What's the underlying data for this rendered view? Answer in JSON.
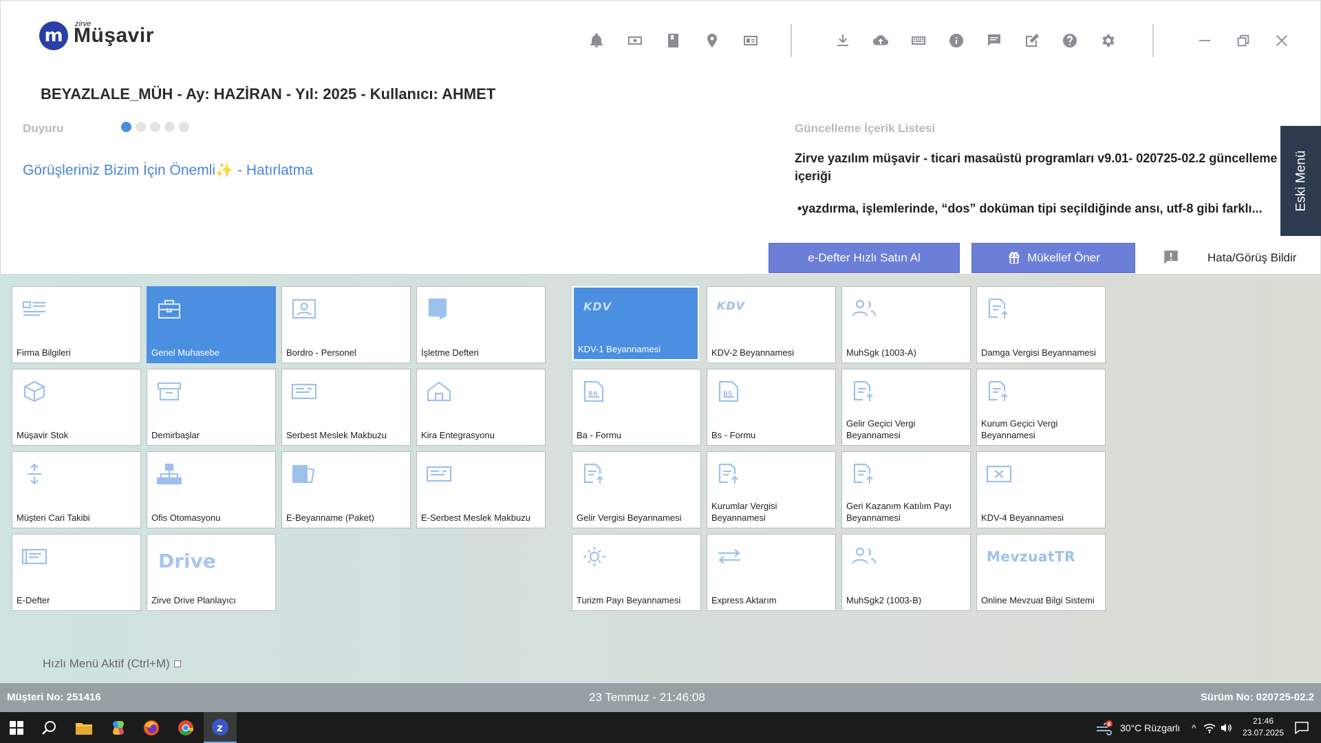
{
  "app": {
    "logo_small": "zirve",
    "logo_name": "Müşavir",
    "logo_mark": "m"
  },
  "toolbar_icons": [
    "bell-icon",
    "money-icon",
    "book-icon",
    "location-icon",
    "card-icon",
    "download-icon",
    "cloud-upload-icon",
    "keyboard-icon",
    "info-icon",
    "chat-icon",
    "edit-note-icon",
    "help-icon",
    "gear-icon"
  ],
  "context_title": "BEYAZLALE_MÜH - Ay: HAZİRAN - Yıl: 2025 - Kullanıcı: AHMET",
  "announcement": {
    "label": "Duyuru",
    "link_text": "Görüşleriniz Bizim İçin Önemli",
    "link_suffix": " - Hatırlatma",
    "sparkle": "✨",
    "dots": 5,
    "active_dot": 0
  },
  "update": {
    "label": "Güncelleme İçerik Listesi",
    "title": "Zirve yazılım müşavir - ticari masaüstü programları v9.01- 020725-02.2 güncelleme içeriği",
    "bullet": "•yazdırma, işlemlerinde, “dos” doküman tipi seçildiğinde ansı, utf-8 gibi farklı..."
  },
  "eski_menu": "Eski Menü",
  "actions": {
    "edefter": "e-Defter Hızlı Satın Al",
    "mukellef": "Mükellef Öner",
    "feedback": "Hata/Görüş Bildir"
  },
  "tiles_left": [
    {
      "label": "Firma Bilgileri",
      "icon": "id-card-icon"
    },
    {
      "label": "Genel Muhasebe",
      "icon": "briefcase-icon",
      "selected": true
    },
    {
      "label": "Bordro - Personel",
      "icon": "person-card-icon"
    },
    {
      "label": "İşletme Defteri",
      "icon": "notebook-icon"
    },
    {
      "label": "Müşavir Stok",
      "icon": "box-icon"
    },
    {
      "label": "Demirbaşlar",
      "icon": "archive-icon"
    },
    {
      "label": "Serbest Meslek Makbuzu",
      "icon": "receipt-icon"
    },
    {
      "label": "Kira Entegrasyonu",
      "icon": "home-icon"
    },
    {
      "label": "Müşteri Cari Takibi",
      "icon": "transfer-icon"
    },
    {
      "label": "Ofis Otomasyonu",
      "icon": "org-chart-icon"
    },
    {
      "label": "E-Beyanname (Paket)",
      "icon": "package-icon"
    },
    {
      "label": "E-Serbest Meslek Makbuzu",
      "icon": "e-receipt-icon"
    },
    {
      "label": "E-Defter",
      "icon": "ledger-icon"
    },
    {
      "label": "Zirve Drive Planlayıcı",
      "icon": "drive-logo",
      "brand": "Drive"
    }
  ],
  "tiles_right": [
    {
      "label": "KDV-1 Beyannamesi",
      "icon": "kdv-logo",
      "brand": "KDV",
      "selected": true
    },
    {
      "label": "KDV-2 Beyannamesi",
      "icon": "kdv-logo",
      "brand": "KDV"
    },
    {
      "label": "MuhSgk (1003-A)",
      "icon": "people-icon"
    },
    {
      "label": "Damga Vergisi Beyannamesi",
      "icon": "doc-upload-icon"
    },
    {
      "label": "Ba - Formu",
      "icon": "ba-doc-icon"
    },
    {
      "label": "Bs - Formu",
      "icon": "bs-doc-icon"
    },
    {
      "label": "Gelir Geçici Vergi Beyannamesi",
      "icon": "doc-upload-icon"
    },
    {
      "label": "Kurum Geçici Vergi Beyannamesi",
      "icon": "doc-upload-icon"
    },
    {
      "label": "Gelir Vergisi Beyannamesi",
      "icon": "doc-upload-icon"
    },
    {
      "label": "Kurumlar Vergisi Beyannamesi",
      "icon": "doc-upload-icon"
    },
    {
      "label": "Geri Kazanım Katılım Payı Beyannamesi",
      "icon": "doc-upload-icon"
    },
    {
      "label": "KDV-4 Beyannamesi",
      "icon": "kdv4-icon"
    },
    {
      "label": "Turizm Payı Beyannamesi",
      "icon": "sun-icon"
    },
    {
      "label": "Express Aktarım",
      "icon": "arrows-icon"
    },
    {
      "label": "MuhSgk2 (1003-B)",
      "icon": "people-icon"
    },
    {
      "label": "Online Mevzuat Bilgi Sistemi",
      "icon": "mevzuat-logo",
      "brand": "MevzuatTR"
    }
  ],
  "quick_menu": "Hızlı Menü Aktif (Ctrl+M)",
  "status": {
    "customer": "Müşteri No: 251416",
    "datetime": "23 Temmuz - 21:46:08",
    "version": "Sürüm No: 020725-02.2"
  },
  "taskbar": {
    "apps": [
      "windows-start-icon",
      "search-icon",
      "file-explorer-icon",
      "copilot-icon",
      "firefox-icon",
      "chrome-icon",
      "zirve-app-icon"
    ],
    "weather": "30°C  Rüzgarlı",
    "weather_badge": "6",
    "time": "21:46",
    "date": "23.07.2025"
  }
}
